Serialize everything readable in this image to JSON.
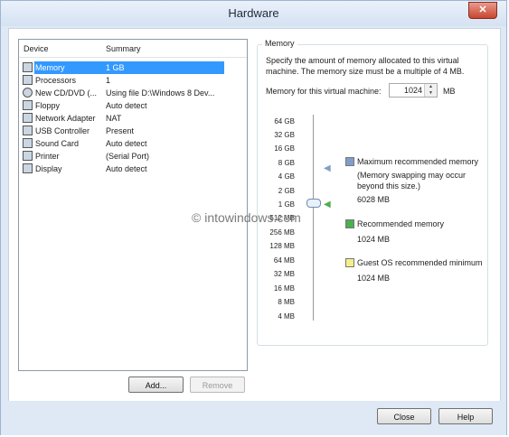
{
  "window": {
    "title": "Hardware"
  },
  "device_list": {
    "columns": [
      "Device",
      "Summary"
    ],
    "rows": [
      {
        "device": "Memory",
        "summary": "1 GB",
        "selected": true
      },
      {
        "device": "Processors",
        "summary": "1"
      },
      {
        "device": "New CD/DVD (...",
        "summary": "Using file D:\\Windows 8 Dev..."
      },
      {
        "device": "Floppy",
        "summary": "Auto detect"
      },
      {
        "device": "Network Adapter",
        "summary": "NAT"
      },
      {
        "device": "USB Controller",
        "summary": "Present"
      },
      {
        "device": "Sound Card",
        "summary": "Auto detect"
      },
      {
        "device": "Printer",
        "summary": "(Serial Port)"
      },
      {
        "device": "Display",
        "summary": "Auto detect"
      }
    ],
    "add_label": "Add...",
    "remove_label": "Remove"
  },
  "memory": {
    "group_title": "Memory",
    "description": "Specify the amount of memory allocated to this virtual machine. The memory size must be a multiple of 4 MB.",
    "field_label": "Memory for this virtual machine:",
    "value": "1024",
    "unit": "MB",
    "scale_ticks": [
      "64 GB",
      "32 GB",
      "16 GB",
      "8 GB",
      "4 GB",
      "2 GB",
      "1 GB",
      "512 MB",
      "256 MB",
      "128 MB",
      "64 MB",
      "32 MB",
      "16 MB",
      "8 MB",
      "4 MB"
    ],
    "max_recommended": {
      "label": "Maximum recommended memory",
      "note": "(Memory swapping may occur beyond this size.)",
      "value": "6028 MB",
      "color": "#7f9fc8"
    },
    "recommended": {
      "label": "Recommended memory",
      "value": "1024 MB",
      "color": "#4caf50"
    },
    "guest_min": {
      "label": "Guest OS recommended minimum",
      "value": "1024 MB",
      "color": "#f4ef8c"
    }
  },
  "watermark": "© intowindows.com",
  "buttons": {
    "close": "Close",
    "help": "Help"
  }
}
